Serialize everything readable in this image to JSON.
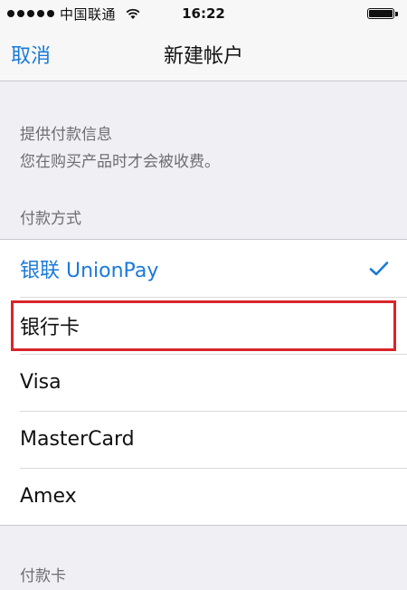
{
  "status_bar": {
    "carrier": "中国联通",
    "time": "16:22",
    "signal_icon": "signal-dots-icon",
    "wifi_icon": "wifi-icon",
    "battery_icon": "battery-icon"
  },
  "nav": {
    "cancel_label": "取消",
    "title": "新建帐户"
  },
  "payment_info": {
    "title": "提供付款信息",
    "note": "您在购买产品时才会被收费。"
  },
  "payment_method": {
    "header": "付款方式",
    "options": [
      {
        "label": "银联 UnionPay",
        "selected": true
      },
      {
        "label": "银行卡",
        "selected": false
      },
      {
        "label": "Visa",
        "selected": false
      },
      {
        "label": "MasterCard",
        "selected": false
      },
      {
        "label": "Amex",
        "selected": false
      }
    ],
    "checkmark_icon": "checkmark-icon"
  },
  "card_section": {
    "header": "付款卡"
  },
  "colors": {
    "accent": "#1a7ad9",
    "highlight": "#d8262a",
    "background": "#efeff4"
  }
}
